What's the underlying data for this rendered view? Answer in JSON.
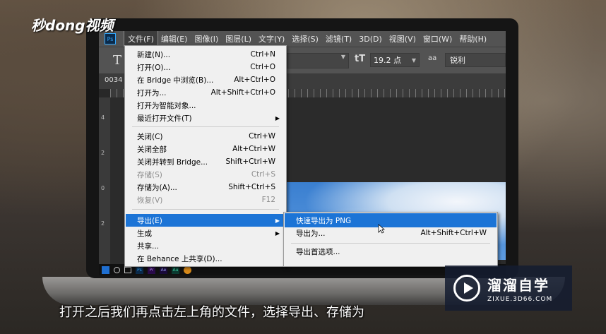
{
  "logo_top_left": "秒dong视频",
  "menubar": {
    "items": [
      "文件(F)",
      "编辑(E)",
      "图像(I)",
      "图层(L)",
      "文字(Y)",
      "选择(S)",
      "滤镜(T)",
      "3D(D)",
      "视图(V)",
      "窗口(W)",
      "帮助(H)"
    ],
    "ps_icon": "Ps"
  },
  "options": {
    "tool_glyph": "T",
    "size_icon": "tT",
    "font_size": "19.2 点",
    "aa_icon": "aa",
    "aa_value": "锐利"
  },
  "tab": {
    "title": "0034"
  },
  "ruler_v_numbers": [
    "4",
    "2",
    "0",
    "2"
  ],
  "file_menu": [
    {
      "label": "新建(N)...",
      "shortcut": "Ctrl+N"
    },
    {
      "label": "打开(O)...",
      "shortcut": "Ctrl+O"
    },
    {
      "label": "在 Bridge 中浏览(B)...",
      "shortcut": "Alt+Ctrl+O"
    },
    {
      "label": "打开为...",
      "shortcut": "Alt+Shift+Ctrl+O"
    },
    {
      "label": "打开为智能对象...",
      "shortcut": ""
    },
    {
      "label": "最近打开文件(T)",
      "shortcut": ""
    },
    {
      "label": "关闭(C)",
      "shortcut": "Ctrl+W"
    },
    {
      "label": "关闭全部",
      "shortcut": "Alt+Ctrl+W"
    },
    {
      "label": "关闭并转到 Bridge...",
      "shortcut": "Shift+Ctrl+W"
    },
    {
      "label": "存储(S)",
      "shortcut": "Ctrl+S"
    },
    {
      "label": "存储为(A)...",
      "shortcut": "Shift+Ctrl+S"
    },
    {
      "label": "恢复(V)",
      "shortcut": "F12"
    },
    {
      "label": "导出(E)",
      "shortcut": ""
    },
    {
      "label": "生成",
      "shortcut": ""
    },
    {
      "label": "共享...",
      "shortcut": ""
    },
    {
      "label": "在 Behance 上共享(D)...",
      "shortcut": ""
    }
  ],
  "export_submenu": [
    {
      "label": "快速导出为 PNG",
      "shortcut": ""
    },
    {
      "label": "导出为...",
      "shortcut": "Alt+Shift+Ctrl+W"
    },
    {
      "label": "导出首选项...",
      "shortcut": ""
    }
  ],
  "taskbar": {
    "icons": [
      "Ps",
      "Pr",
      "Ae",
      "Au"
    ]
  },
  "watermark": {
    "title": "溜溜自学",
    "url": "ZIXUE.3D66.COM"
  },
  "subtitle": "打开之后我们再点击左上角的文件，选择导出、存储为"
}
